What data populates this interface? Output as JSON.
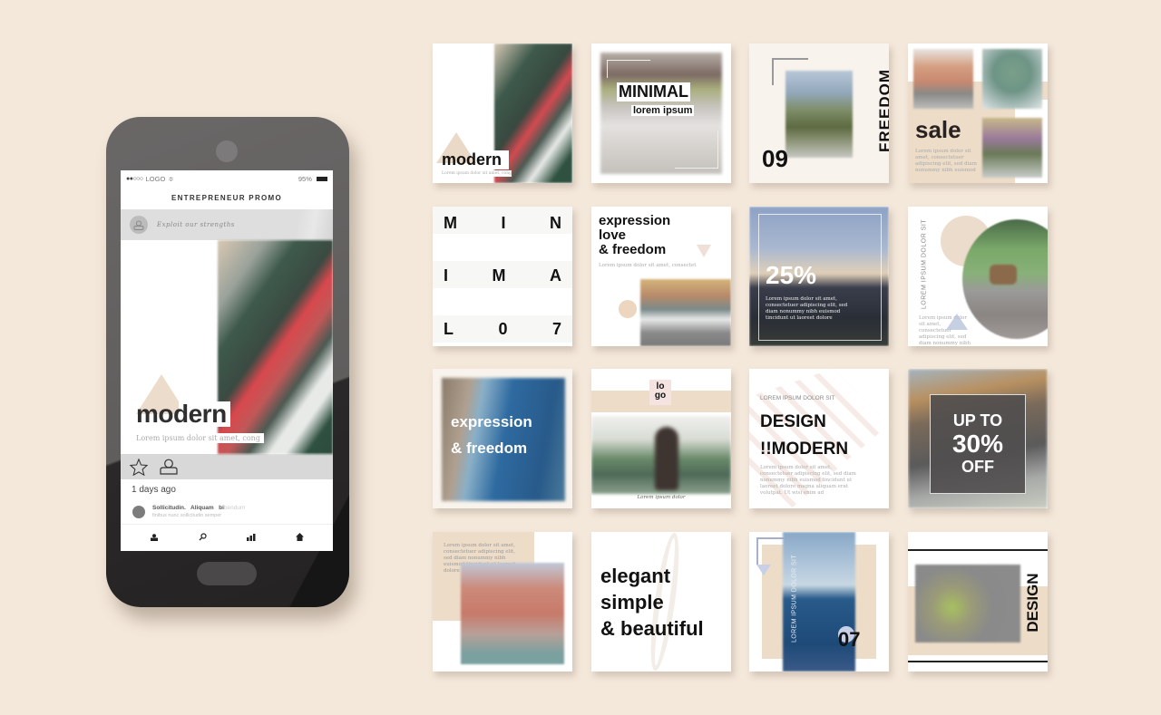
{
  "phone": {
    "status": {
      "signal": "●●○○○",
      "carrier": "LOGO",
      "wifi_icon": "≑",
      "battery": "95%"
    },
    "app_title": "ENTREPRENEUR PROMO",
    "profile_tagline": "Exploit our strengths",
    "post": {
      "headline": "modern",
      "caption": "Lorem ipsum dolor sit amet, cong"
    },
    "actions": {
      "star_icon": "☆",
      "user_icon": "user"
    },
    "time_ago": "1 days ago",
    "comment": {
      "author": "Sollicitudin.",
      "bold2": "Aliquam",
      "bold3": "bi",
      "faded": "bendum",
      "sub": "finibus nunc sollicitudin semper"
    },
    "tabbar": [
      "profile-icon",
      "search-icon",
      "stats-icon",
      "home-icon"
    ]
  },
  "templates": {
    "modern": {
      "word": "modern",
      "caption": "Lorem ipsum dolor sit amet, cong"
    },
    "minimal": {
      "title": "MINIMAL",
      "subtitle": "lorem ipsum"
    },
    "freedom": {
      "number": "09",
      "word": "FREEDOM"
    },
    "sale": {
      "word": "sale",
      "caption": "Lorem ipsum dolor sit amet, consectetuer adipiscing elit, sed diam nonummy nibh euismod"
    },
    "minimal07": {
      "rows": [
        [
          "M",
          "I",
          "N"
        ],
        [
          "I",
          "M",
          "A"
        ],
        [
          "L",
          "0",
          "7"
        ]
      ]
    },
    "expression": {
      "title_lines": [
        "expression",
        "love",
        "& freedom"
      ],
      "caption": "Lorem ipsum dolor sit amet, consectet"
    },
    "percent25": {
      "value": "25%",
      "caption": "Lorem ipsum dolor sit amet, consectetuer adipiscing elit, sed diam nonummy nibh euismod tincidunt ut laoreet dolore"
    },
    "goat": {
      "vertical": "LOREM IPSUM DOLOR SIT",
      "caption": "Lorem ipsum dolor sit amet, consectetuer adipiscing elit, sed diam nonummy nibh euismod"
    },
    "expression_freedom": {
      "lines": [
        "expression",
        "& freedom"
      ]
    },
    "logo": {
      "logo_lines": [
        "lo",
        "go"
      ],
      "signature": "Lorem ipsum dolor"
    },
    "design_modern": {
      "subtitle": "LOREM IPSUM DOLOR SIT",
      "line1": "DESIGN",
      "line2": "!!MODERN",
      "caption": "Lorem ipsum dolor sit amet, consectetuer adipiscing elit, sed diam nonummy nibh euismod tincidunt ut laoreet dolore magna aliquam erat volutpat. Ut wisi enim ad"
    },
    "upto30": {
      "line1": "UP TO",
      "line2": "30%",
      "line3": "OFF"
    },
    "lorem_photo": {
      "caption": "Lorem ipsum dolor sit amet, consectetuer adipiscing elit, sed diam nonummy nibh euismod tincidunt ut laoreet dolore"
    },
    "elegant": {
      "lines": [
        "elegant",
        "simple",
        "& beautiful"
      ]
    },
    "seven": {
      "vertical": "LOREM IPSUM DOLOR SIT",
      "number": "07"
    },
    "design_vertical": {
      "word": "DESIGN"
    }
  }
}
